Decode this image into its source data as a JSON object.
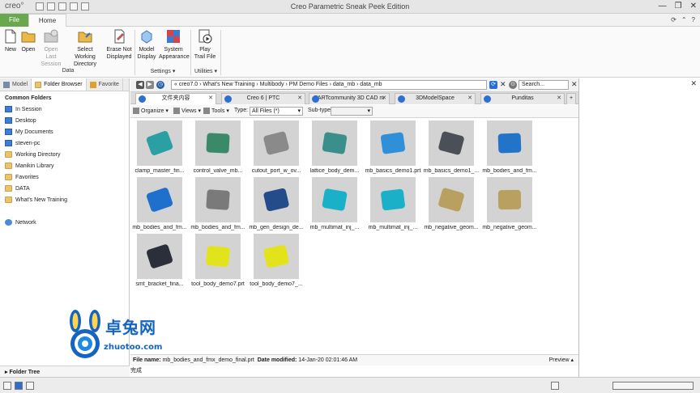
{
  "titlebar": {
    "logo": "creo°",
    "title": "Creo Parametric Sneak Peek Edition",
    "minimize": "—",
    "restore": "❐",
    "close": "✕"
  },
  "tabs": {
    "file": "File",
    "home": "Home"
  },
  "ribbon": {
    "new": "New",
    "open": "Open",
    "open_last_session": "Open Last Session",
    "select_working_directory": "Select Working Directory",
    "erase_not_displayed": "Erase Not Displayed",
    "data_group": "Data",
    "model_display": "Model Display",
    "system_appearance": "System Appearance",
    "settings_group": "Settings",
    "play_trail_file": "Play Trail File",
    "utilities_group": "Utilities"
  },
  "left_panel": {
    "tabs": [
      "Model",
      "Folder Browser",
      "Favorite"
    ],
    "common_folders_title": "Common Folders",
    "items": [
      {
        "label": "In Session",
        "icon": "session-icon"
      },
      {
        "label": "Desktop",
        "icon": "desktop-icon"
      },
      {
        "label": "My Documents",
        "icon": "documents-icon"
      },
      {
        "label": "steven-pc",
        "icon": "computer-icon"
      },
      {
        "label": "Working Directory",
        "icon": "folder-icon"
      },
      {
        "label": "Manikin Library",
        "icon": "folder-icon"
      },
      {
        "label": "Favorites",
        "icon": "folder-icon"
      },
      {
        "label": "DATA",
        "icon": "folder-icon"
      },
      {
        "label": "What's New Training",
        "icon": "folder-icon"
      }
    ],
    "network": "Network",
    "folder_tree": "Folder Tree"
  },
  "browser": {
    "address_path": "« creo7.0 › What's New Training › Multibody › PM Demo Files › data_mb › data_mb",
    "search_placeholder": "Search...",
    "tabs": [
      {
        "label": "文件夹内容",
        "active": true
      },
      {
        "label": "Creo 6 | PTC",
        "active": false
      },
      {
        "label": "PARTcommunity 3D CAD m",
        "active": false
      },
      {
        "label": "3DModelSpace",
        "active": false
      },
      {
        "label": "Punditas",
        "active": false
      }
    ],
    "toolbar": {
      "organize": "Organize",
      "views": "Views",
      "tools": "Tools",
      "type_label": "Type:",
      "type_value": "All Files (*)",
      "subtype_label": "Sub-type:",
      "subtype_value": ""
    },
    "files": [
      {
        "name": "clamp_master_fin...",
        "color": "#2a9fa4"
      },
      {
        "name": "control_valve_mb...",
        "color": "#3a8a6a"
      },
      {
        "name": "cutout_port_w_ov...",
        "color": "#8a8a8a"
      },
      {
        "name": "lattice_body_dem...",
        "color": "#3a8f8a"
      },
      {
        "name": "mb_basics_demo1.prt",
        "color": "#2f8fd8"
      },
      {
        "name": "mb_basics_demo1_...",
        "color": "#4a4f58"
      },
      {
        "name": "mb_bodies_and_fm...",
        "color": "#2274c9"
      },
      {
        "name": "mb_bodies_and_fm...",
        "color": "#1f6fcc"
      },
      {
        "name": "mb_bodies_and_fm...",
        "color": "#7a7a7a"
      },
      {
        "name": "mb_gen_design_de...",
        "color": "#244b8a"
      },
      {
        "name": "mb_multimat_inj_...",
        "color": "#19b0c8"
      },
      {
        "name": "mb_multimat_inj_...",
        "color": "#19b0c8"
      },
      {
        "name": "mb_negative_geom...",
        "color": "#b8a060"
      },
      {
        "name": "mb_negative_geom...",
        "color": "#b8a060"
      },
      {
        "name": "smt_bracket_fina...",
        "color": "#2a2f3a"
      },
      {
        "name": "tool_body_demo7.prt",
        "color": "#e3e31c"
      },
      {
        "name": "tool_body_demo7_...",
        "color": "#e3e31c"
      }
    ],
    "info": {
      "file_name_label": "File name:",
      "file_name": "mb_bodies_and_fmx_demo_final.prt",
      "date_label": "Date modified:",
      "date": "14-Jan-20 02:01:46 AM",
      "preview": "Preview ▴"
    },
    "status": "完成"
  },
  "watermark": {
    "brand": "卓兔网",
    "url": "zhuotoo.com"
  }
}
